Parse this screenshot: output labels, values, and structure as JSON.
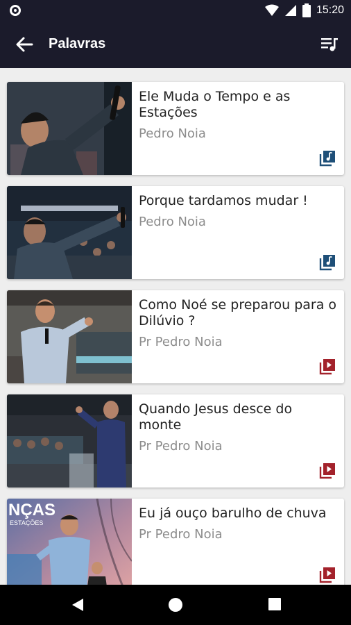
{
  "status_bar": {
    "time": "15:20"
  },
  "app_bar": {
    "title": "Palavras"
  },
  "items": [
    {
      "title": "Ele Muda o Tempo e as Estações",
      "author": "Pedro Noia",
      "media": "audio",
      "media_color": "#1e4f78"
    },
    {
      "title": "Porque tardamos mudar !",
      "author": "Pedro Noia",
      "media": "audio",
      "media_color": "#1e4f78"
    },
    {
      "title": "Como Noé se preparou para o Dilúvio ?",
      "author": "Pr Pedro Noia",
      "media": "video",
      "media_color": "#a3222b"
    },
    {
      "title": "Quando Jesus desce do monte",
      "author": "Pr Pedro Noia",
      "media": "video",
      "media_color": "#a3222b"
    },
    {
      "title": "Eu já ouço barulho de chuva",
      "author": "Pr Pedro Noia",
      "media": "video",
      "media_color": "#a3222b"
    }
  ],
  "thumb_overlay_text": {
    "banner": "NÇAS",
    "sub": "ESTAÇÕES"
  },
  "icons": {
    "back": "arrow-back-icon",
    "queue": "playlist-music-icon",
    "audio": "music-library-icon",
    "video": "video-library-icon",
    "nav_back": "triangle-back-icon",
    "nav_home": "circle-home-icon",
    "nav_recent": "square-recent-icon"
  }
}
